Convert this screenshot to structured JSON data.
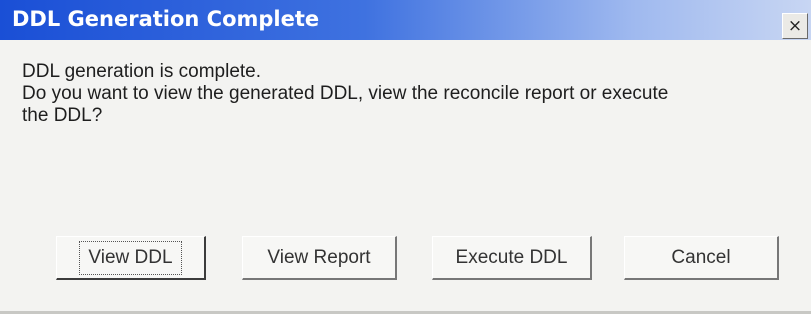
{
  "dialog": {
    "title": "DDL Generation Complete",
    "close_glyph": "×",
    "close_icon": "close-icon",
    "message_lines": [
      "DDL generation is complete.",
      "Do you want to view the generated DDL, view the reconcile report or execute",
      "the DDL?"
    ],
    "buttons": {
      "view_ddl": "View DDL",
      "view_report": "View Report",
      "execute_ddl": "Execute DDL",
      "cancel": "Cancel"
    },
    "default_button": "view_ddl"
  },
  "colors": {
    "titlebar_start": "#1a4fd6",
    "titlebar_end": "#c8d6f3",
    "dialog_background": "#f3f3f1"
  }
}
